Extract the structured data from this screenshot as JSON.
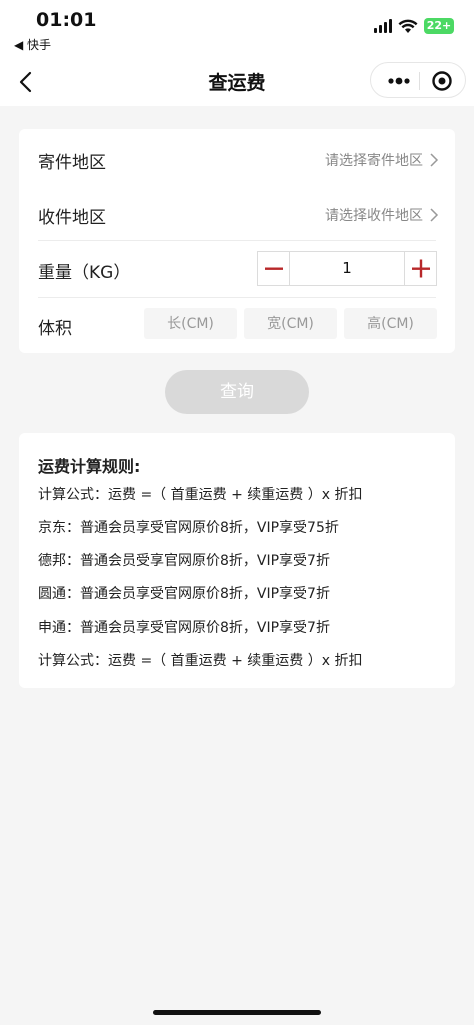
{
  "status_bar": {
    "time": "01:01",
    "back_app": "◀ 快手",
    "battery": "22+"
  },
  "nav": {
    "title": "查运费",
    "back_icon": "chevron-left-icon",
    "more_icon": "more-dots-icon",
    "close_icon": "target-circle-icon"
  },
  "form": {
    "sender_region": {
      "label": "寄件地区",
      "placeholder": "请选择寄件地区"
    },
    "receiver_region": {
      "label": "收件地区",
      "placeholder": "请选择收件地区"
    },
    "weight": {
      "label": "重量（KG）",
      "value": "1"
    },
    "volume": {
      "label": "体积",
      "length_placeholder": "长(CM)",
      "width_placeholder": "宽(CM)",
      "height_placeholder": "高(CM)"
    },
    "query_button": "查询"
  },
  "colors": {
    "accent": "#b8282a",
    "disabled_button": "#d9d9d9",
    "background": "#f5f5f5"
  },
  "rules": {
    "title": "运费计算规则:",
    "lines": [
      "计算公式：运费 =（ 首重运费 + 续重运费 ）x 折扣",
      "京东：普通会员享受官网原价8折，VIP享受75折",
      "德邦：普通会员受享官网原价8折，VIP享受7折",
      "圆通：普通会员享受官网原价8折，VIP享受7折",
      "申通：普通会员享受官网原价8折，VIP享受7折",
      "计算公式：运费 =（ 首重运费 + 续重运费 ）x 折扣"
    ]
  }
}
